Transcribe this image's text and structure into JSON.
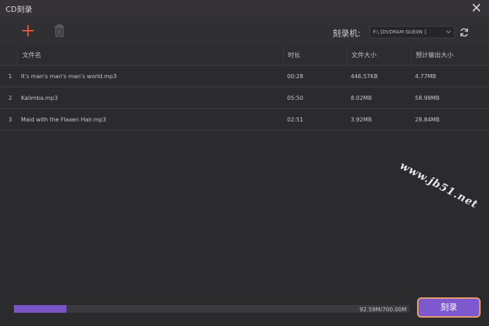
{
  "window": {
    "title": "CD刻录",
    "close_icon": "close-icon"
  },
  "toolbar": {
    "add_icon": "plus-icon",
    "delete_icon": "trash-icon",
    "burner_label": "刻录机:",
    "drive_value": "F:\\ [DVDRAM GUE0N ]",
    "refresh_icon": "refresh-icon"
  },
  "table": {
    "columns": [
      "文件名",
      "时长",
      "文件大小",
      "预计输出大小"
    ],
    "rows": [
      {
        "index": "1",
        "name": "It's man's man's man's world.mp3",
        "duration": "00:28",
        "size": "446.57KB",
        "estimated": "4.77MB"
      },
      {
        "index": "2",
        "name": "Kalimba.mp3",
        "duration": "05:50",
        "size": "8.02MB",
        "estimated": "58.98MB"
      },
      {
        "index": "3",
        "name": "Maid with the Flaxen Hair.mp3",
        "duration": "02:51",
        "size": "3.92MB",
        "estimated": "28.84MB"
      }
    ]
  },
  "watermark": "www.jb51.net",
  "capacity": {
    "text": "92.59M/700.00M",
    "used_fraction": 0.132
  },
  "burn_label": "刻录",
  "colors": {
    "accent": "#7e58cf",
    "burn_border": "#f0a06a",
    "add_icon": "#e8553f"
  }
}
